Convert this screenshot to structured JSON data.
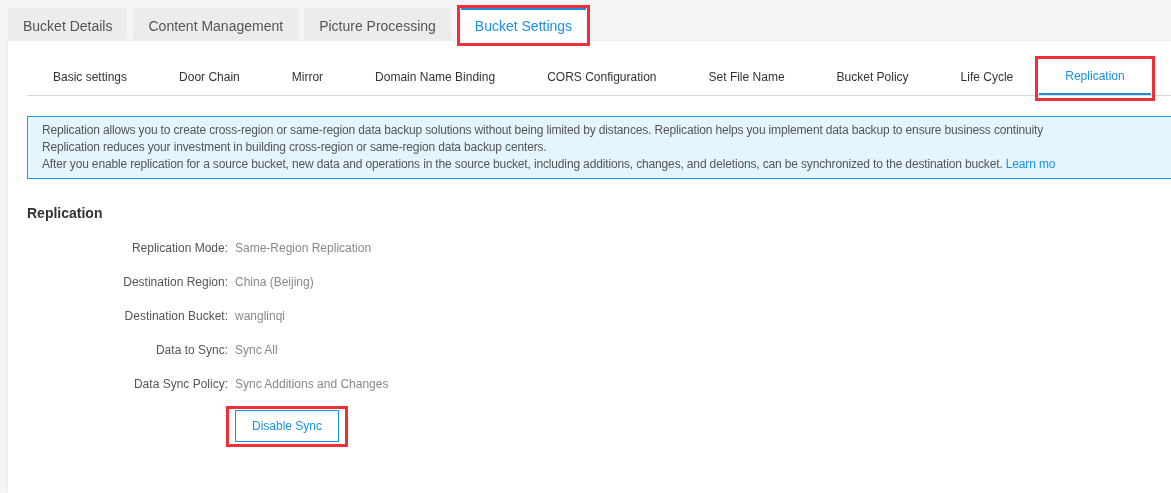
{
  "tabs": [
    {
      "label": "Bucket Details",
      "selected": false,
      "highlighted": false
    },
    {
      "label": "Content Management",
      "selected": false,
      "highlighted": false
    },
    {
      "label": "Picture Processing",
      "selected": false,
      "highlighted": false
    },
    {
      "label": "Bucket Settings",
      "selected": true,
      "highlighted": true
    }
  ],
  "subtabs": [
    {
      "label": "Basic settings",
      "selected": false,
      "highlighted": false
    },
    {
      "label": "Door Chain",
      "selected": false,
      "highlighted": false
    },
    {
      "label": "Mirror",
      "selected": false,
      "highlighted": false
    },
    {
      "label": "Domain Name Binding",
      "selected": false,
      "highlighted": false
    },
    {
      "label": "CORS Configuration",
      "selected": false,
      "highlighted": false
    },
    {
      "label": "Set File Name",
      "selected": false,
      "highlighted": false
    },
    {
      "label": "Bucket Policy",
      "selected": false,
      "highlighted": false
    },
    {
      "label": "Life Cycle",
      "selected": false,
      "highlighted": false
    },
    {
      "label": "Replication",
      "selected": true,
      "highlighted": true
    }
  ],
  "notice": {
    "lines": [
      "Replication allows you to create cross-region or same-region data backup solutions without being limited by distances. Replication helps you implement data backup to ensure business continuity",
      "Replication reduces your investment in building cross-region or same-region data backup centers.",
      "After you enable replication for a source bucket, new data and operations in the source bucket, including additions, changes, and deletions, can be synchronized to the destination bucket."
    ],
    "link": "Learn mo"
  },
  "section": {
    "title": "Replication",
    "fields": [
      {
        "label": "Replication Mode:",
        "value": "Same-Region Replication"
      },
      {
        "label": "Destination Region:",
        "value": "China (Beijing)"
      },
      {
        "label": "Destination Bucket:",
        "value": "wanglinqi"
      },
      {
        "label": "Data to Sync:",
        "value": "Sync All"
      },
      {
        "label": "Data Sync Policy:",
        "value": "Sync Additions and Changes"
      }
    ],
    "button": {
      "label": "Disable Sync",
      "highlighted": true
    }
  }
}
